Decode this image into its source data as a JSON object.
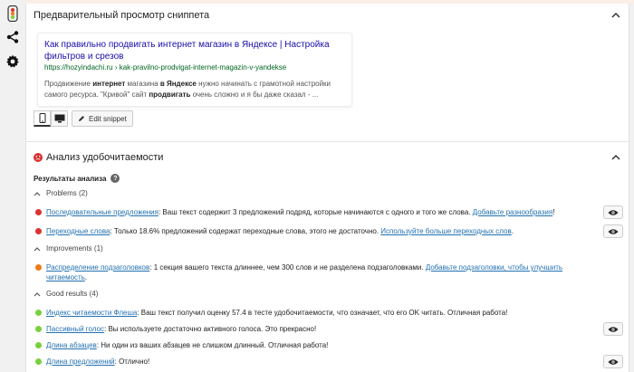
{
  "snippet_preview": {
    "section_title": "Предварительный просмотр сниппета",
    "title": "Как правильно продвигать интернет магазин в Яндексе | Настройка фильтров и срезов",
    "url": "https://hozyindachi.ru › kak-pravilno-prodvigat-internet-magazin-v-yandekse",
    "desc_parts": [
      "Продвижение ",
      "интернет",
      " магазина ",
      "в Яндексе",
      " нужно начинать с грамотной настройки самого ресурса. \"Кривой\" сайт ",
      "продвигать",
      " очень сложно и я бы даже сказал - ..."
    ],
    "edit_label": "Edit snippet"
  },
  "readability": {
    "section_title": "Анализ удобочитаемости",
    "results_heading": "Результаты анализа",
    "help_glyph": "?",
    "groups": [
      {
        "label": "Problems (2)",
        "items": [
          {
            "color": "#dc3232",
            "link": "Последовательные предложения",
            "text": ": Ваш текст содержит 3 предложений подряд, которые начинаются с одного и того же слова. ",
            "link2": "Добавьте разнообразия",
            "tail": "!",
            "eye": true
          },
          {
            "color": "#dc3232",
            "link": "Переходные слова",
            "text": ": Только 18.6% предложений содержат переходные слова, этого не достаточно. ",
            "link2": "Используйте больше переходных слов",
            "tail": ".",
            "eye": true
          }
        ]
      },
      {
        "label": "Improvements (1)",
        "items": [
          {
            "color": "#ee7c1b",
            "link": "Распределение подзаголовков",
            "text": ": 1 секция вашего текста длиннее, чем 300 слов и не разделена подзаголовками. ",
            "link2": "Добавьте подзаголовки, чтобы улучшить читаемость",
            "tail": ".",
            "eye": false
          }
        ]
      },
      {
        "label": "Good results (4)",
        "items": [
          {
            "color": "#7ad03a",
            "link": "Индекс читаемости Флеша",
            "text": ": Ваш текст получил оценку 57.4 в тесте удобочитаемости, что означает, что его OK читать. Отличная работа!",
            "link2": "",
            "tail": "",
            "eye": false
          },
          {
            "color": "#7ad03a",
            "link": "Пассивный голос",
            "text": ": Вы используете достаточно активного голоса. Это прекрасно!",
            "link2": "",
            "tail": "",
            "eye": true
          },
          {
            "color": "#7ad03a",
            "link": "Длина абзацев",
            "text": ": Ни один из ваших абзацев не слишком длинный. Отличная работа!",
            "link2": "",
            "tail": "",
            "eye": false
          },
          {
            "color": "#7ad03a",
            "link": "Длина предложений",
            "text": ": Отлично!",
            "link2": "",
            "tail": "",
            "eye": true
          }
        ]
      }
    ]
  },
  "sidebar": {
    "icons": [
      "traffic-light-icon",
      "share-icon",
      "gear-icon"
    ]
  }
}
